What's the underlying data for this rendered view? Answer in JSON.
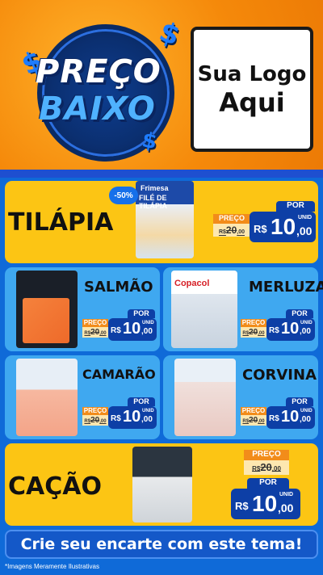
{
  "header": {
    "title_line1": "PREÇO",
    "title_line2": "BAIXO",
    "logo_line1": "Sua Logo",
    "logo_line2": "Aqui",
    "dollar_glyph": "$"
  },
  "products": [
    {
      "name": "TILÁPIA",
      "package_brand": "Frimesa",
      "package_text": "FILÉ DE TILÁPIA",
      "discount": "-50%",
      "old_label": "PREÇO",
      "old_prefix": "R$",
      "old_value": "20",
      "old_cents": ",00",
      "por": "POR",
      "rs": "R$",
      "price": "10",
      "cents": ",00",
      "unid": "UNID"
    },
    {
      "name": "SALMÃO",
      "package_brand": "",
      "package_text": "",
      "old_label": "PREÇO",
      "old_prefix": "R$",
      "old_value": "20",
      "old_cents": ",00",
      "por": "POR",
      "rs": "R$",
      "price": "10",
      "cents": ",00",
      "unid": "UNID"
    },
    {
      "name": "MERLUZA",
      "package_brand": "Copacol",
      "package_text": "",
      "old_label": "PREÇO",
      "old_prefix": "R$",
      "old_value": "20",
      "old_cents": ",00",
      "por": "POR",
      "rs": "R$",
      "price": "10",
      "cents": ",00",
      "unid": "UNID"
    },
    {
      "name": "CAMARÃO",
      "package_brand": "",
      "package_text": "",
      "old_label": "PREÇO",
      "old_prefix": "R$",
      "old_value": "20",
      "old_cents": ",00",
      "por": "POR",
      "rs": "R$",
      "price": "10",
      "cents": ",00",
      "unid": "UNID"
    },
    {
      "name": "CORVINA",
      "package_brand": "",
      "package_text": "",
      "old_label": "PREÇO",
      "old_prefix": "R$",
      "old_value": "20",
      "old_cents": ",00",
      "por": "POR",
      "rs": "R$",
      "price": "10",
      "cents": ",00",
      "unid": "UNID"
    },
    {
      "name": "CAÇÃO",
      "package_brand": "",
      "package_text": "",
      "old_label": "PREÇO",
      "old_prefix": "R$",
      "old_value": "20",
      "old_cents": ",00",
      "por": "POR",
      "rs": "R$",
      "price": "10",
      "cents": ",00",
      "unid": "UNID"
    }
  ],
  "footer": {
    "cta": "Crie seu encarte com este tema!",
    "note": "*Imagens Meramente Ilustrativas"
  },
  "colors": {
    "yellow": "#fcc514",
    "blue": "#3fa8f0",
    "navy": "#0d3fa6",
    "orange": "#f28c1a"
  }
}
